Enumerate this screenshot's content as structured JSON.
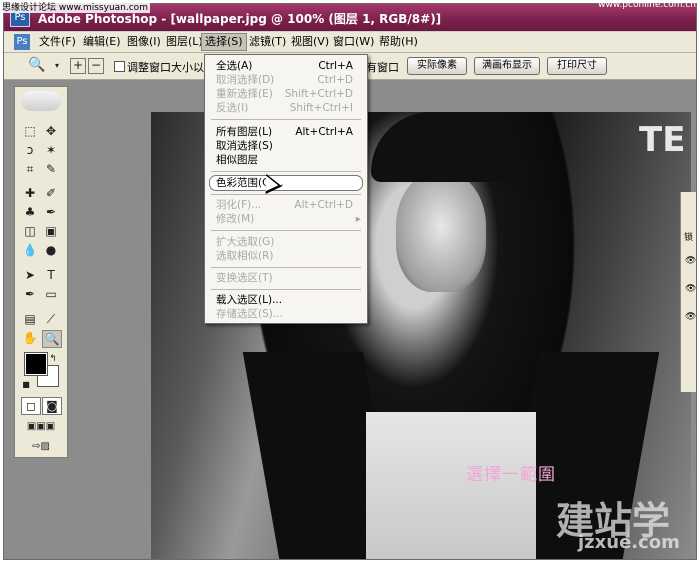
{
  "watermark_top_left": "思缘设计论坛 www.missyuan.com",
  "watermark_top_right": "www.pconline.com.cn",
  "window": {
    "title": "Adobe Photoshop - [wallpaper.jpg @ 100% (图层 1, RGB/8#)]",
    "app_icon": "ps-app-icon"
  },
  "menu": [
    {
      "label": "文件(F)"
    },
    {
      "label": "编辑(E)"
    },
    {
      "label": "图像(I)"
    },
    {
      "label": "图层(L)"
    },
    {
      "label": "选择(S)"
    },
    {
      "label": "滤镜(T)"
    },
    {
      "label": "视图(V)"
    },
    {
      "label": "窗口(W)"
    },
    {
      "label": "帮助(H)"
    }
  ],
  "options": {
    "checkbox_label": "调整窗口大小以",
    "right_text": "有窗口",
    "btn_actual": "实际像素",
    "btn_fit": "满画布显示",
    "btn_print": "打印尺寸"
  },
  "select_menu": {
    "all": {
      "label": "全选(A)",
      "shortcut": "Ctrl+A"
    },
    "deselect": {
      "label": "取消选择(D)",
      "shortcut": "Ctrl+D"
    },
    "reselect": {
      "label": "重新选择(E)",
      "shortcut": "Shift+Ctrl+D"
    },
    "inverse": {
      "label": "反选(I)",
      "shortcut": "Shift+Ctrl+I"
    },
    "all_layers": {
      "label": "所有图层(L)",
      "shortcut": "Alt+Ctrl+A"
    },
    "deselect_layers": {
      "label": "取消选择(S)"
    },
    "similar_layers": {
      "label": "相似图层"
    },
    "color_range": {
      "label": "色彩范围(C)..."
    },
    "feather": {
      "label": "羽化(F)...",
      "shortcut": "Alt+Ctrl+D"
    },
    "modify": {
      "label": "修改(M)",
      "arrow": "▸"
    },
    "grow": {
      "label": "扩大选取(G)"
    },
    "similar": {
      "label": "选取相似(R)"
    },
    "transform": {
      "label": "变换选区(T)"
    },
    "load": {
      "label": "载入选区(L)..."
    },
    "save": {
      "label": "存储选区(S)..."
    }
  },
  "canvas_text": "TE",
  "right_panel_label": "锁",
  "caption": "選擇一範圍",
  "logo_watermark": "建站学",
  "logo_url": "jzxue.com",
  "colors": {
    "titlebar": "#7b1f4c",
    "caption": "#f3a6d6",
    "menu_bg": "#ece9d8"
  }
}
